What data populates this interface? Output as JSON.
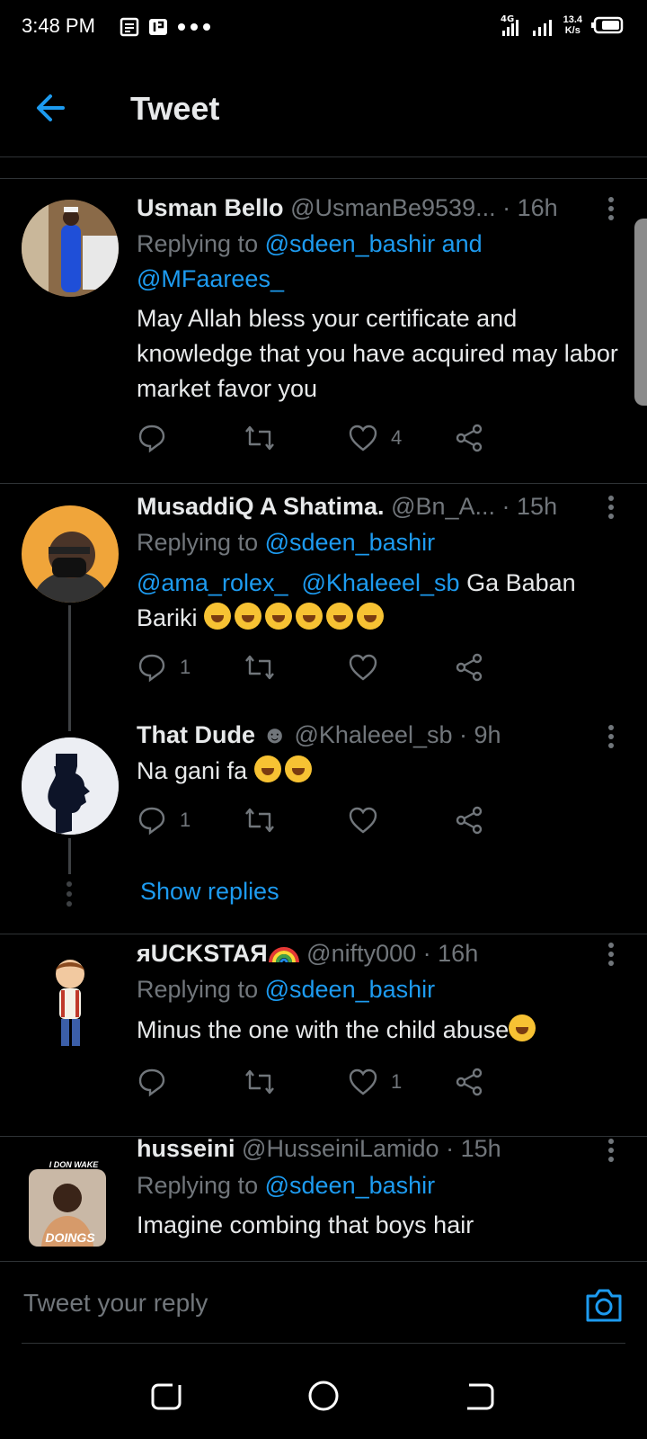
{
  "status": {
    "time": "3:48 PM",
    "net_top": "13.4",
    "net_bottom": "K/s",
    "signal": "4G"
  },
  "header": {
    "title": "Tweet"
  },
  "tweets": [
    {
      "name": "Usman Bello",
      "handle": "@UsmanBe9539...",
      "time": "· 16h",
      "reply_prefix": "Replying to",
      "reply_users": "@sdeen_bashir and",
      "reply_users2": "@MFaarees_",
      "body": "May Allah bless your certificate and knowledge that you have acquired may labor market favor you",
      "replies": "",
      "retweets": "",
      "likes": "4"
    },
    {
      "name": "MusaddiQ A Shatima.",
      "handle": "@Bn_A...",
      "time": "· 15h",
      "reply_prefix": "Replying to",
      "reply_users": "@sdeen_bashir",
      "mention1": "@ama_rolex_",
      "mention2": "@Khaleeel_sb",
      "body": "Ga Baban Bariki",
      "replies": "1",
      "retweets": "",
      "likes": ""
    },
    {
      "name": "That Dude",
      "handle": "@Khaleeel_sb",
      "time": "· 9h",
      "body": "Na gani fa",
      "replies": "1",
      "retweets": "",
      "likes": "",
      "show_replies": "Show replies"
    },
    {
      "name": "яUCKSTAЯ",
      "handle": "@nifty000",
      "time": "· 16h",
      "reply_prefix": "Replying to",
      "reply_users": "@sdeen_bashir",
      "body": "Minus the one with the child abuse",
      "replies": "",
      "retweets": "",
      "likes": "1"
    },
    {
      "name": "husseini",
      "handle": "@HusseiniLamido",
      "time": "· 15h",
      "reply_prefix": "Replying to",
      "reply_users": "@sdeen_bashir",
      "body": "Imagine combing that boys hair",
      "avatar_caption_top": "I DON WAKE",
      "avatar_caption_bottom": "DOINGS"
    }
  ],
  "composer": {
    "placeholder": "Tweet your reply"
  },
  "colors": {
    "accent": "#1d9bf0",
    "muted": "#71767b",
    "text": "#e7e9ea",
    "bg": "#000000"
  }
}
